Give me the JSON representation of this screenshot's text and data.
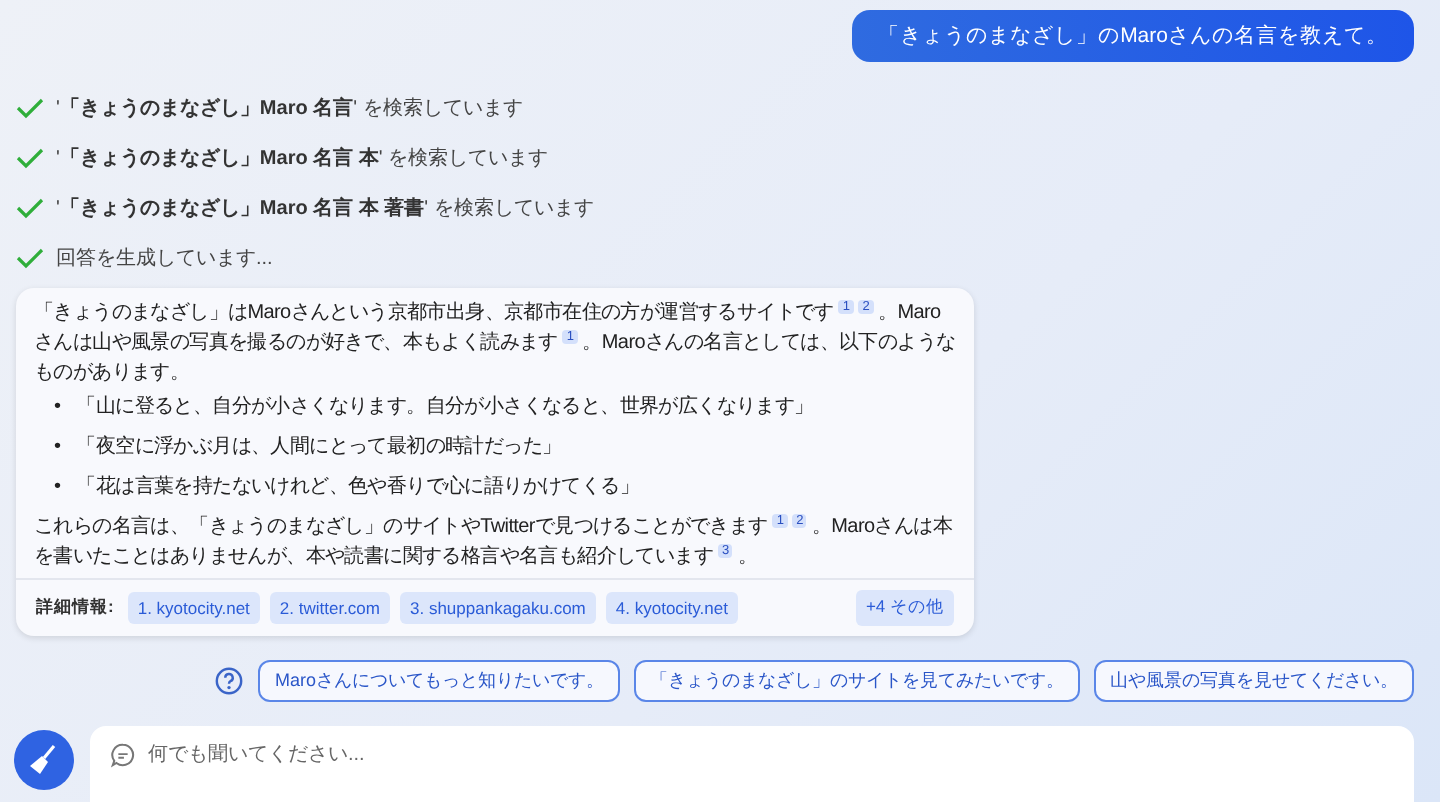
{
  "user_message": "「きょうのまなざし」のMaroさんの名言を教えて。",
  "search_steps": [
    {
      "text": "'**「きょうのまなざし」Maro 名言**' を検索しています",
      "done": true
    },
    {
      "text": "'**「きょうのまなざし」Maro 名言 本**' を検索しています",
      "done": true
    },
    {
      "text": "'**「きょうのまなざし」Maro 名言 本 著書**' を検索しています",
      "done": true
    },
    {
      "text": "回答を生成しています...",
      "done": true
    }
  ],
  "answer": {
    "blocks": [
      {
        "kind": "paragraph",
        "text": "「きょうのまなざし」はMaroさんという京都市出身、京都市在住の方が運営するサイトです $^{1}$ $^{2}$ 。Maroさんは山や風景の写真を撮るのが好きで、本もよく読みます $^{1}$ 。Maroさんの名言としては、以下のようなものがあります。"
      },
      {
        "kind": "bullets",
        "marker": "•",
        "items": [
          "「山に登ると、自分が小さくなります。自分が小さくなると、世界が広くなります」",
          "「夜空に浮かぶ月は、人間にとって最初の時計だった」",
          "「花は言葉を持たないけれど、色や香りで心に語りかけてくる」"
        ]
      },
      {
        "kind": "paragraph",
        "text": "これらの名言は、「きょうのまなざし」のサイトやTwitterで見つけることができます $^{1}$ $^{2}$ 。Maroさんは本を書いたことはありませんが、本や読書に関する格言や名言も紹介しています $^{3}$ 。"
      }
    ],
    "sources": {
      "label": "詳細情報:",
      "links": [
        "1. kyotocity.net",
        "2. twitter.com",
        "3. shuppankagaku.com",
        "4. kyotocity.net"
      ],
      "more": "+4 その他"
    }
  },
  "suggestions": [
    "Maroさんについてもっと知りたいです。",
    "「きょうのまなざし」のサイトを見てみたいです。",
    "山や風景の写真を見せてください。"
  ],
  "input": {
    "placeholder": "何でも聞いてください..."
  }
}
